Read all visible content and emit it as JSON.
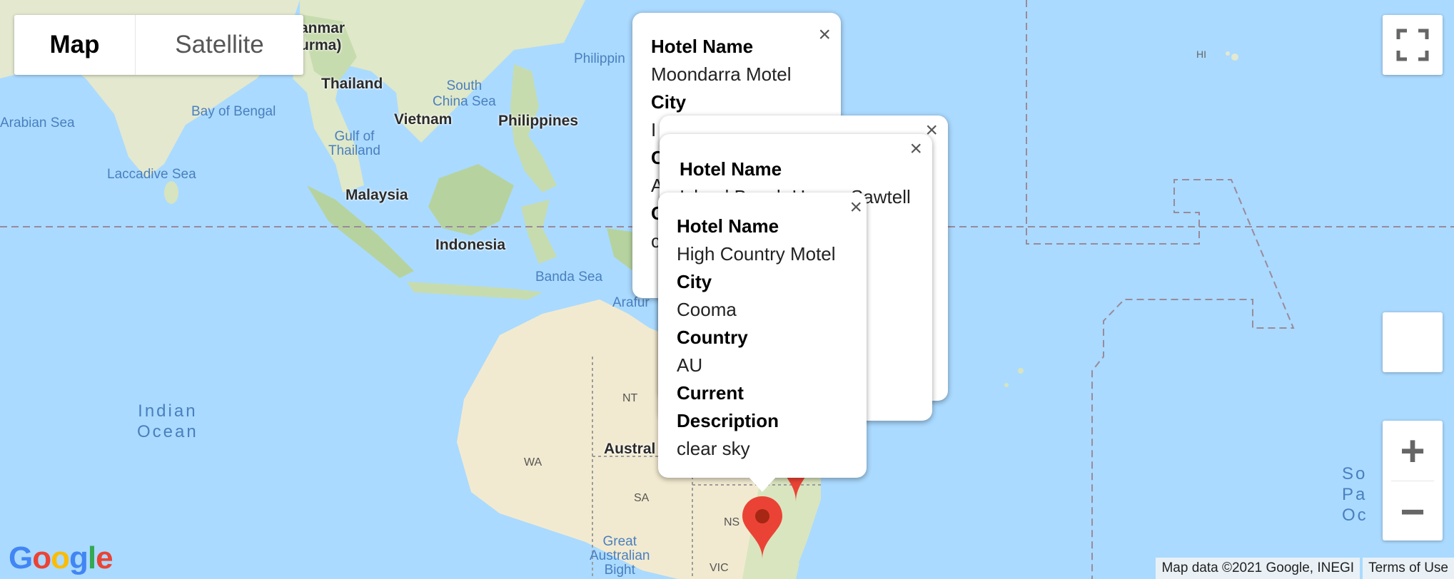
{
  "map_type": {
    "map_label": "Map",
    "satellite_label": "Satellite"
  },
  "labels": {
    "myanmar": "anmar\nurma)",
    "thailand": "Thailand",
    "bay_of_bengal": "Bay of Bengal",
    "arabian_sea": "Arabian Sea",
    "laccadive_sea": "Laccadive Sea",
    "vietnam": "Vietnam",
    "gulf_of_thailand": "Gulf of\nThailand",
    "south_china_sea": "South\nChina Sea",
    "philippines": "Philippines",
    "philippine_sea": "Philippin",
    "malaysia": "Malaysia",
    "indonesia": "Indonesia",
    "banda_sea": "Banda Sea",
    "arafura": "Arafur",
    "indian_ocean": "Indian\nOcean",
    "nt": "NT",
    "wa": "WA",
    "sa": "SA",
    "nsw": "NS",
    "vic": "VIC",
    "australia": "Austral",
    "great_australian_bight": "Great\nAustralian\nBight",
    "hi": "HI",
    "south_pacific": "So\nPa\nOc"
  },
  "info_windows": [
    {
      "hotel_name_label": "Hotel Name",
      "hotel_name": "Moondarra Motel",
      "city_label": "City",
      "city": "I",
      "country_partial": "C",
      "country_value_partial": "A",
      "desc_partial": "C",
      "desc_value_partial": "c"
    },
    {
      "hotel_name_label": "Hotel Name",
      "hotel_name": "Island Beach House Sawtell"
    },
    {
      "hotel_name_label": "Hotel Name",
      "hotel_name": "High Country Motel",
      "city_label": "City",
      "city": "Cooma",
      "country_label": "Country",
      "country": "AU",
      "desc_label": "Current Description",
      "desc": "clear sky"
    }
  ],
  "controls": {
    "close_glyph": "×",
    "zoom_in": "+",
    "zoom_out": "−"
  },
  "attribution": {
    "map_data": "Map data ©2021 Google, INEGI",
    "terms": "Terms of Use"
  },
  "google_logo": "Google",
  "colors": {
    "water": "#aadaff",
    "land": "#e8ecd8",
    "desert": "#f3eccd",
    "forest": "#bcd9a6",
    "marker": "#ea4335"
  }
}
